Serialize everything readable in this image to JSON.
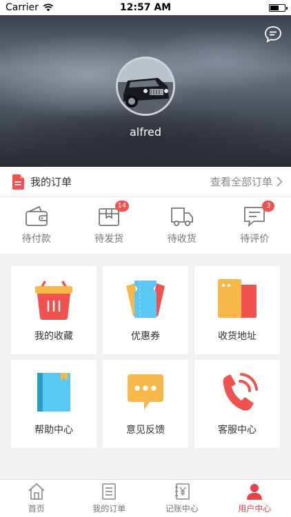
{
  "status_bar": {
    "carrier": "Carrier",
    "time": "12:57 AM"
  },
  "profile": {
    "username": "alfred"
  },
  "orders": {
    "title": "我的订单",
    "view_all": "查看全部订单",
    "items": [
      {
        "label": "待付款",
        "icon": "wallet-icon",
        "badge": ""
      },
      {
        "label": "待发货",
        "icon": "package-icon",
        "badge": "14"
      },
      {
        "label": "待收货",
        "icon": "truck-icon",
        "badge": ""
      },
      {
        "label": "待评价",
        "icon": "comment-icon",
        "badge": "3"
      }
    ]
  },
  "services": [
    {
      "label": "我的收藏",
      "icon": "basket-icon"
    },
    {
      "label": "优惠券",
      "icon": "coupon-icon"
    },
    {
      "label": "收货地址",
      "icon": "address-icon"
    },
    {
      "label": "帮助中心",
      "icon": "book-icon"
    },
    {
      "label": "意见反馈",
      "icon": "feedback-icon"
    },
    {
      "label": "客服中心",
      "icon": "phone-icon"
    }
  ],
  "tabs": [
    {
      "label": "首页",
      "icon": "home-icon"
    },
    {
      "label": "我的订单",
      "icon": "list-icon"
    },
    {
      "label": "记账中心",
      "icon": "ledger-icon"
    },
    {
      "label": "用户中心",
      "icon": "user-icon",
      "active": true
    }
  ],
  "colors": {
    "accent": "#e8414a",
    "badge": "#f0524f"
  }
}
